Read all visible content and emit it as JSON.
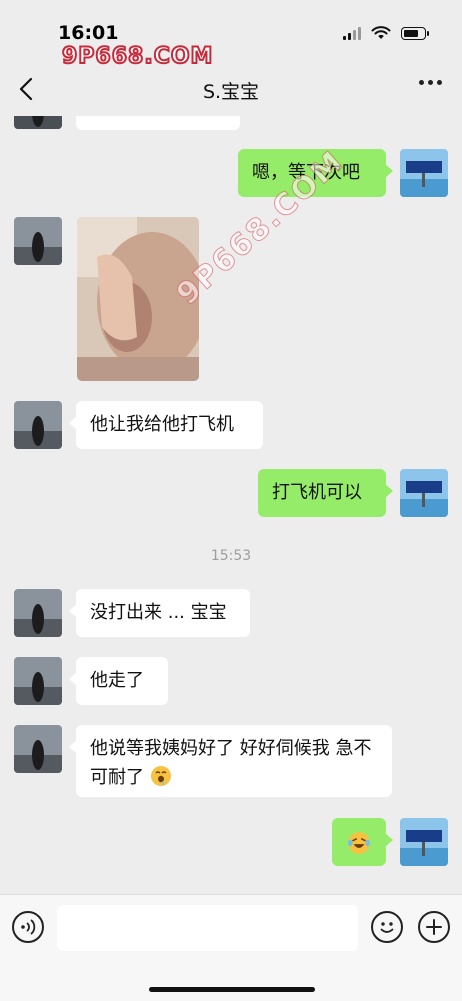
{
  "status_bar": {
    "time": "16:01",
    "watermark": "9P668.COM",
    "icons": [
      "cellular-signal-icon",
      "wifi-icon",
      "battery-icon"
    ]
  },
  "nav": {
    "title": "S.宝宝",
    "back_icon": "chevron-left-icon",
    "more_icon": "more-dots-icon"
  },
  "watermark_diagonal": "9P668.COM",
  "messages": [
    {
      "side": "in",
      "type": "text",
      "text": ""
    },
    {
      "side": "out",
      "type": "text",
      "text": "嗯，等下次吧"
    },
    {
      "side": "in",
      "type": "image",
      "text": ""
    },
    {
      "side": "in",
      "type": "text",
      "text": "他让我给他打飞机"
    },
    {
      "side": "out",
      "type": "text",
      "text": "打飞机可以"
    },
    {
      "side": "system",
      "type": "time",
      "text": "15:53"
    },
    {
      "side": "in",
      "type": "text",
      "text": "没打出来 ... 宝宝"
    },
    {
      "side": "in",
      "type": "text",
      "text": "他走了"
    },
    {
      "side": "in",
      "type": "text",
      "text": "他说等我姨妈好了 好好伺候我 急不可耐了",
      "emoji": "drooling-face-emoji"
    },
    {
      "side": "out",
      "type": "emoji",
      "text": "",
      "emoji": "laughing-tears-emoji"
    }
  ],
  "input_bar": {
    "voice_icon": "voice-icon",
    "input_value": "",
    "emoji_icon": "smiley-icon",
    "plus_icon": "plus-icon"
  },
  "colors": {
    "background": "#ededed",
    "bubble_in": "#ffffff",
    "bubble_out": "#95ec69",
    "watermark": "#c62b3c"
  }
}
